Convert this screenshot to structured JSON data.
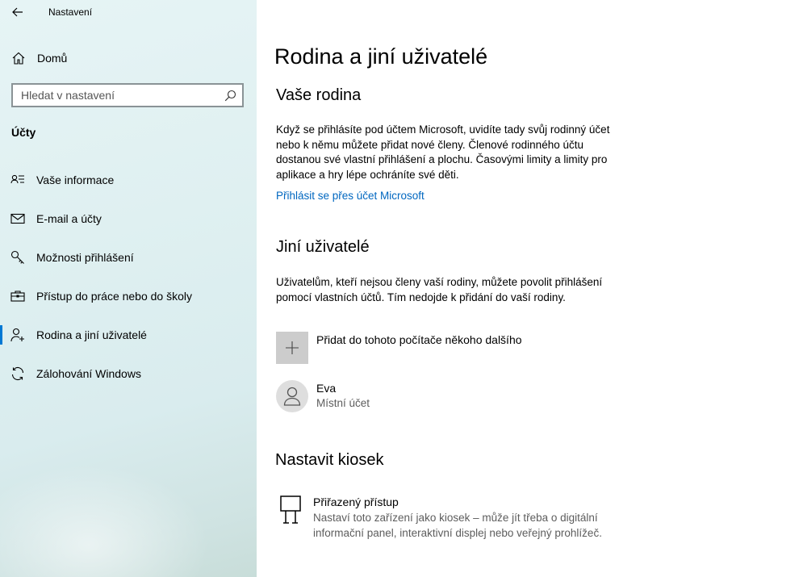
{
  "app": {
    "title": "Nastavení"
  },
  "sidebar": {
    "home_label": "Domů",
    "search_placeholder": "Hledat v nastavení",
    "section_title": "Účty",
    "items": [
      {
        "label": "Vaše informace",
        "icon": "person-card-icon",
        "selected": false
      },
      {
        "label": "E-mail a účty",
        "icon": "mail-icon",
        "selected": false
      },
      {
        "label": "Možnosti přihlášení",
        "icon": "key-icon",
        "selected": false
      },
      {
        "label": "Přístup do práce nebo do školy",
        "icon": "briefcase-icon",
        "selected": false
      },
      {
        "label": "Rodina a jiní uživatelé",
        "icon": "add-person-icon",
        "selected": true
      },
      {
        "label": "Zálohování Windows",
        "icon": "sync-icon",
        "selected": false
      }
    ]
  },
  "main": {
    "page_title": "Rodina a jiní uživatelé",
    "family": {
      "heading": "Vaše rodina",
      "description": "Když se přihlásíte pod účtem Microsoft, uvidíte tady svůj rodinný účet nebo k němu můžete přidat nové členy. Členové rodinného účtu dostanou své vlastní přihlášení a plochu. Časovými limity a limity pro aplikace a hry lépe ochráníte své děti.",
      "link": "Přihlásit se přes účet Microsoft"
    },
    "others": {
      "heading": "Jiní uživatelé",
      "description": "Uživatelům, kteří nejsou členy vaší rodiny, můžete povolit přihlášení pomocí vlastních účtů. Tím nedojde k přidání do vaší rodiny.",
      "add_label": "Přidat do tohoto počítače někoho dalšího",
      "users": [
        {
          "name": "Eva",
          "type": "Místní účet"
        }
      ]
    },
    "kiosk": {
      "heading": "Nastavit kiosek",
      "title": "Přiřazený přístup",
      "description": "Nastaví toto zařízení jako kiosek – může jít třeba o digitální informační panel, interaktivní displej nebo veřejný prohlížeč."
    }
  },
  "colors": {
    "accent": "#0078d4",
    "link": "#0067c0"
  }
}
